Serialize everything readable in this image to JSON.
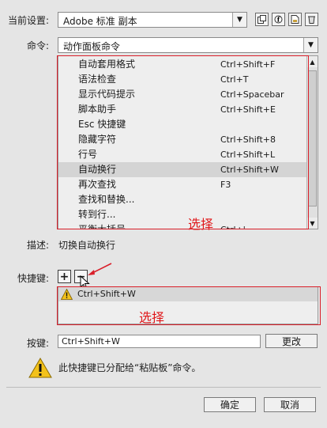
{
  "preset": {
    "label": "当前设置:",
    "value": "Adobe 标准 副本",
    "tool_icons": [
      "duplicate-set-icon",
      "rename-set-icon",
      "export-set-icon",
      "delete-set-icon"
    ]
  },
  "command": {
    "label": "命令:",
    "value": "动作面板命令"
  },
  "command_list": {
    "items": [
      {
        "name": "自动套用格式",
        "key": "Ctrl+Shift+F"
      },
      {
        "name": "语法检查",
        "key": "Ctrl+T"
      },
      {
        "name": "显示代码提示",
        "key": "Ctrl+Spacebar"
      },
      {
        "name": "脚本助手",
        "key": "Ctrl+Shift+E"
      },
      {
        "name": "Esc 快捷键",
        "key": ""
      },
      {
        "name": "隐藏字符",
        "key": "Ctrl+Shift+8"
      },
      {
        "name": "行号",
        "key": "Ctrl+Shift+L"
      },
      {
        "name": "自动换行",
        "key": "Ctrl+Shift+W"
      },
      {
        "name": "再次查找",
        "key": "F3"
      },
      {
        "name": "查找和替换...",
        "key": ""
      },
      {
        "name": "转到行...",
        "key": ""
      },
      {
        "name": "平衡大括号",
        "key": "Ctrl+'"
      }
    ],
    "selected_index": 7
  },
  "annotation_1": "选择",
  "description": {
    "label": "描述:",
    "value": "切换自动换行"
  },
  "shortcut": {
    "label": "快捷键:",
    "add_symbol": "+",
    "remove_symbol": "−",
    "items": [
      {
        "key": "Ctrl+Shift+W",
        "warning": true
      }
    ]
  },
  "annotation_2": "选择",
  "keypress": {
    "label": "按键:",
    "value": "Ctrl+Shift+W",
    "change_label": "更改"
  },
  "message": "此快捷键已分配给“粘贴板”命令。",
  "footer": {
    "ok_label": "确定",
    "cancel_label": "取消"
  },
  "colors": {
    "annotation_red": "#d91f2a",
    "warning_yellow": "#f3c21b"
  }
}
